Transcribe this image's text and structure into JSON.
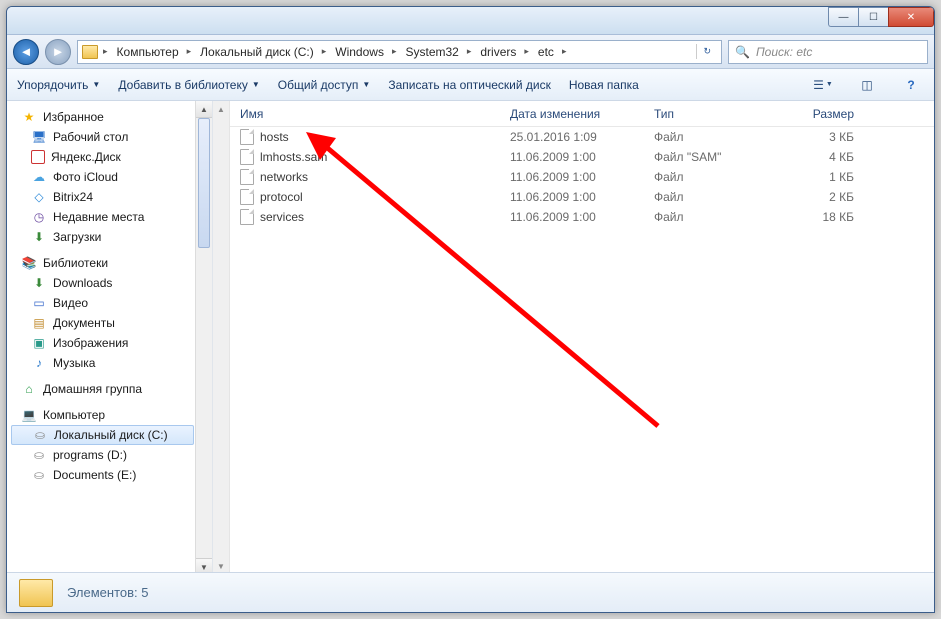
{
  "window": {
    "buttons": {
      "min": "—",
      "max": "☐",
      "close": "✕"
    }
  },
  "nav": {
    "back": "◄",
    "forward": "►",
    "breadcrumb": [
      "Компьютер",
      "Локальный диск (C:)",
      "Windows",
      "System32",
      "drivers",
      "etc"
    ],
    "chevron": "▸",
    "refresh": "↻"
  },
  "search": {
    "placeholder": "Поиск: etc",
    "icon": "🔍"
  },
  "toolbar": {
    "organize": "Упорядочить",
    "add_library": "Добавить в библиотеку",
    "share": "Общий доступ",
    "burn": "Записать на оптический диск",
    "new_folder": "Новая папка",
    "dd": "▼",
    "view_icon": "☰",
    "preview_icon": "◫",
    "help_icon": "?"
  },
  "sidebar": {
    "favorites": {
      "label": "Избранное",
      "icon": "★"
    },
    "fav_items": [
      {
        "label": "Рабочий стол",
        "icon": "🖥",
        "cls": "desk"
      },
      {
        "label": "Яндекс.Диск",
        "icon": "",
        "cls": "ydisk"
      },
      {
        "label": "Фото iCloud",
        "icon": "☁",
        "cls": "cloud"
      },
      {
        "label": "Bitrix24",
        "icon": "◇",
        "cls": "bitrix"
      },
      {
        "label": "Недавние места",
        "icon": "◷",
        "cls": "recent"
      },
      {
        "label": "Загрузки",
        "icon": "⬇",
        "cls": "dl"
      }
    ],
    "libraries": {
      "label": "Библиотеки",
      "icon": "📚"
    },
    "lib_items": [
      {
        "label": "Downloads",
        "icon": "⬇",
        "cls": "dl"
      },
      {
        "label": "Видео",
        "icon": "▭",
        "cls": "vid"
      },
      {
        "label": "Документы",
        "icon": "▤",
        "cls": "doc"
      },
      {
        "label": "Изображения",
        "icon": "▣",
        "cls": "img"
      },
      {
        "label": "Музыка",
        "icon": "♪",
        "cls": "mus"
      }
    ],
    "homegroup": {
      "label": "Домашняя группа",
      "icon": "⌂"
    },
    "computer": {
      "label": "Компьютер",
      "icon": "💻"
    },
    "comp_items": [
      {
        "label": "Локальный диск (C:)",
        "icon": "⛀",
        "cls": "drive",
        "selected": true
      },
      {
        "label": "programs (D:)",
        "icon": "⛀",
        "cls": "drive"
      },
      {
        "label": "Documents (E:)",
        "icon": "⛀",
        "cls": "drive"
      }
    ]
  },
  "columns": {
    "name": "Имя",
    "date": "Дата изменения",
    "type": "Тип",
    "size": "Размер"
  },
  "files": [
    {
      "name": "hosts",
      "date": "25.01.2016 1:09",
      "type": "Файл",
      "size": "3 КБ"
    },
    {
      "name": "lmhosts.sam",
      "date": "11.06.2009 1:00",
      "type": "Файл \"SAM\"",
      "size": "4 КБ"
    },
    {
      "name": "networks",
      "date": "11.06.2009 1:00",
      "type": "Файл",
      "size": "1 КБ"
    },
    {
      "name": "protocol",
      "date": "11.06.2009 1:00",
      "type": "Файл",
      "size": "2 КБ"
    },
    {
      "name": "services",
      "date": "11.06.2009 1:00",
      "type": "Файл",
      "size": "18 КБ"
    }
  ],
  "status": {
    "count_label": "Элементов: 5"
  }
}
